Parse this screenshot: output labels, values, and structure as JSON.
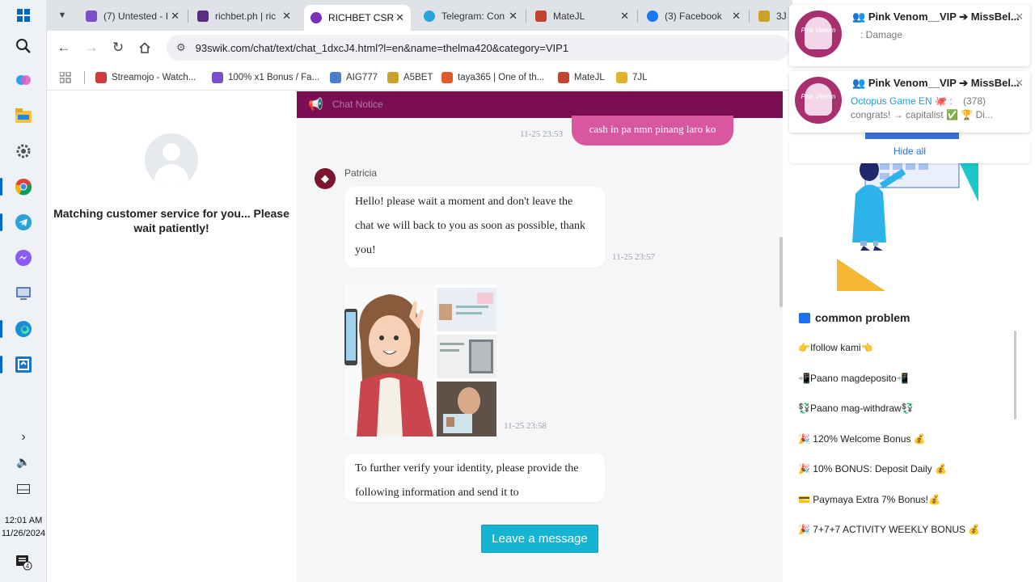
{
  "taskbar": {
    "time": "12:01 AM",
    "date": "11/26/2024",
    "notif_count": "4"
  },
  "browser": {
    "tabs": [
      {
        "title": "(7) Untested - I",
        "color": "#7a4fc9"
      },
      {
        "title": "richbet.ph | ric",
        "color": "#5a2d82"
      },
      {
        "title": "RICHBET CSR",
        "color": "#7b2fb8"
      },
      {
        "title": "Telegram: Con",
        "color": "#2aa3dc"
      },
      {
        "title": "MateJL",
        "color": "#c2442f"
      },
      {
        "title": "(3) Facebook",
        "color": "#1877f2"
      },
      {
        "title": "3J",
        "color": "#c9a227"
      }
    ],
    "url": "93swik.com/chat/text/chat_1dxcJ4.html?l=en&name=thelma420&category=VIP1",
    "bookmarks": [
      {
        "label": "Streamojo - Watch...",
        "color": "#d03a3a"
      },
      {
        "label": "100% x1 Bonus / Fa...",
        "color": "#7a4fc9"
      },
      {
        "label": "AIG777",
        "color": "#4a7bd0"
      },
      {
        "label": "A5BET",
        "color": "#c9a227"
      },
      {
        "label": "taya365 | One of th...",
        "color": "#e05b2a"
      },
      {
        "label": "MateJL",
        "color": "#c2442f"
      },
      {
        "label": "7JL",
        "color": "#e0b22a"
      }
    ]
  },
  "left": {
    "matching_text": "Matching customer service for you... Please wait patiently!"
  },
  "chat": {
    "banner_text": "Chat Notice",
    "messages": {
      "user_msg": "cash in pa nmn pinang laro ko",
      "user_ts": "11-25 23:53",
      "agent_name": "Patricia",
      "agent_msg1": "Hello! please wait a moment and don't leave the chat we will back to you as soon as possible, thank you!",
      "agent_ts1": "11-25 23:57",
      "image_ts": "11-25 23:58",
      "agent_msg2": "To further verify your identity, please provide the following information and send it to"
    },
    "leave_button": "Leave a message"
  },
  "common_problem": {
    "title": "common problem",
    "items": [
      "👉Ifollow kami👈",
      "📲Paano magdeposito📲",
      "💱Paano mag-withdraw💱",
      "🎉 120% Welcome Bonus 💰",
      "🎉 10% BONUS: Deposit Daily 💰",
      "💳 Paymaya Extra 7% Bonus!💰",
      "🎉 7+7+7 ACTIVITY WEEKLY BONUS 💰"
    ]
  },
  "notifications": [
    {
      "title": "Pink Venom__VIP ➔ MissBel...",
      "line1": ": Damage",
      "line2": "",
      "brand": "Pink Venom"
    },
    {
      "title": "Pink Venom__VIP ➔ MissBel...",
      "line1_link": "Octopus Game EN 🐙 :",
      "line1_count": "(378)",
      "line2": "congrats! → capitalist ✅ 🏆 Di...",
      "brand": "Pink Venom"
    }
  ],
  "hide_all": "Hide all",
  "colors": {
    "banner": "#7b0e53",
    "user_bubble": "#d8579f",
    "leave_button": "#16b4d3",
    "link": "#1a73e8"
  }
}
